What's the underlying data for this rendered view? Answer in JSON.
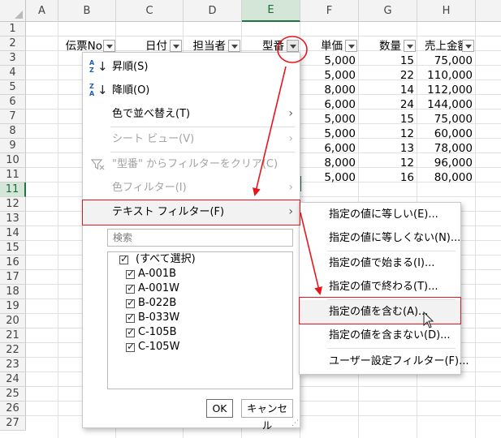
{
  "columns": [
    "A",
    "B",
    "C",
    "D",
    "E",
    "F",
    "G",
    "H"
  ],
  "rows": [
    "1",
    "2",
    "3",
    "4",
    "5",
    "6",
    "7",
    "8",
    "9",
    "10",
    "11",
    "12",
    "13",
    "14",
    "15",
    "16",
    "17",
    "18",
    "19",
    "20",
    "21",
    "22",
    "23",
    "24",
    "25",
    "26",
    "27"
  ],
  "headers": {
    "B": "伝票No",
    "C": "日付",
    "D": "担当者",
    "E": "型番",
    "F": "単価",
    "G": "数量",
    "H": "売上金額"
  },
  "data_rows": [
    {
      "F": "5,000",
      "G": "15",
      "H": "75,000"
    },
    {
      "F": "5,000",
      "G": "22",
      "H": "110,000"
    },
    {
      "F": "8,000",
      "G": "14",
      "H": "112,000"
    },
    {
      "F": "6,000",
      "G": "24",
      "H": "144,000"
    },
    {
      "F": "5,000",
      "G": "15",
      "H": "75,000"
    },
    {
      "F": "5,000",
      "G": "12",
      "H": "60,000"
    },
    {
      "F": "6,000",
      "G": "13",
      "H": "78,000"
    },
    {
      "F": "8,000",
      "G": "12",
      "H": "96,000"
    },
    {
      "F": "5,000",
      "G": "16",
      "H": "80,000"
    }
  ],
  "filter_menu": {
    "sort_asc": "昇順(S)",
    "sort_desc": "降順(O)",
    "sort_color": "色で並べ替え(T)",
    "sheet_view": "シート ビュー(V)",
    "clear_filter": "\"型番\" からフィルターをクリア(C)",
    "color_filter": "色フィルター(I)",
    "text_filter": "テキスト フィルター(F)",
    "search_placeholder": "検索",
    "items": [
      "(すべて選択)",
      "A-001B",
      "A-001W",
      "B-022B",
      "B-033W",
      "C-105B",
      "C-105W"
    ],
    "ok": "OK",
    "cancel": "キャンセル"
  },
  "text_filter_submenu": [
    "指定の値に等しい(E)...",
    "指定の値に等しくない(N)...",
    "指定の値で始まる(I)...",
    "指定の値で終わる(T)...",
    "指定の値を含む(A)...",
    "指定の値を含まない(D)...",
    "ユーザー設定フィルター(F)..."
  ],
  "colors": {
    "annotation_red": "#e8141b",
    "excel_green": "#217346"
  }
}
